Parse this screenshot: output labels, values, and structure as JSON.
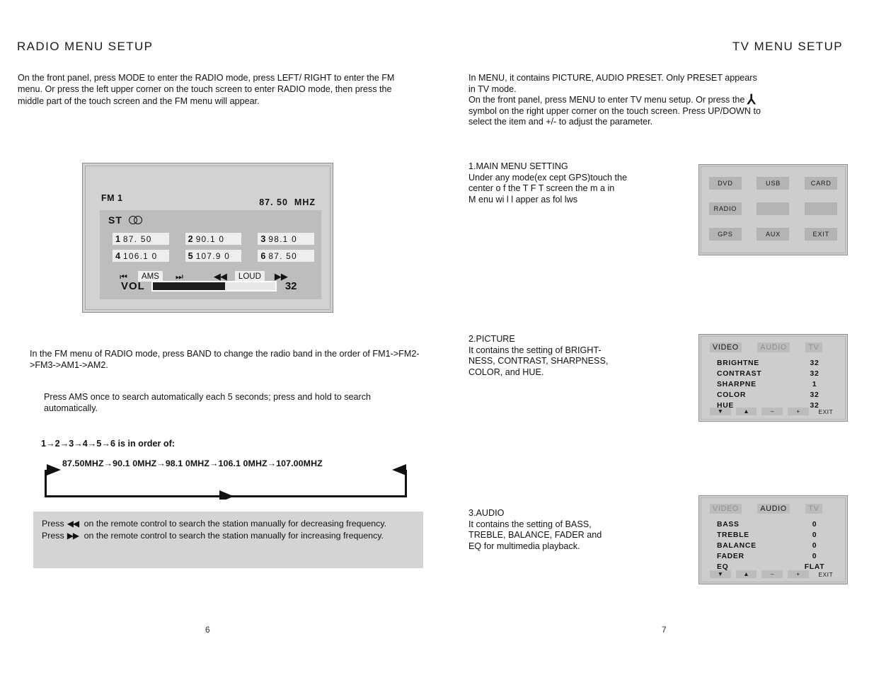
{
  "left_page": {
    "title": "RADIO MENU SETUP",
    "intro": "On the front panel, press MODE to enter the RADIO mode, press LEFT/ RIGHT to enter the FM menu. Or press the left upper corner on the touch screen to enter RADIO mode, then press the middle part of the touch screen and the FM menu will appear.",
    "radio_panel": {
      "band": "FM 1",
      "frequency": "87. 50",
      "frequency_unit": "MHZ",
      "stereo_label": "ST",
      "stereo_icon": "stereo-circles-icon",
      "presets": [
        {
          "num": "1",
          "value": "87. 50"
        },
        {
          "num": "2",
          "value": "90.1 0"
        },
        {
          "num": "3",
          "value": "98.1 0"
        },
        {
          "num": "4",
          "value": "106.1 0"
        },
        {
          "num": "5",
          "value": "107.9 0"
        },
        {
          "num": "6",
          "value": "87. 50"
        }
      ],
      "controls": [
        {
          "label": "⏮",
          "name": "prev-track-button",
          "boxed": false
        },
        {
          "label": "AMS",
          "name": "ams-button",
          "boxed": true
        },
        {
          "label": "⏭",
          "name": "next-track-button",
          "boxed": false
        },
        {
          "label": "◀◀",
          "name": "rewind-button",
          "boxed": false
        },
        {
          "label": "LOUD",
          "name": "loud-button",
          "boxed": true
        },
        {
          "label": "▶▶",
          "name": "fast-forward-button",
          "boxed": false
        }
      ],
      "vol_label": "VOL",
      "vol_value": "32",
      "vol_percent": 59
    },
    "band_text": "In the FM menu of RADIO mode, press BAND to change the radio band in the order of FM1->FM2->FM3->AM1->AM2.",
    "ams_text": "Press AMS once to search automatically each 5 seconds; press and hold to search automatically.",
    "order_label": "1→2→3→4→5→6 is in order of:",
    "flow_sequence": "87.50MHZ→90.1 0MHZ→98.1 0MHZ→106.1 0MHZ→107.00MHZ",
    "note": {
      "line1_pre": "Press",
      "line1_glyph": "◀◀",
      "line1_post": "on the remote control to search the station manually for decreasing frequency.",
      "line2_pre": "Press",
      "line2_glyph": "▶▶",
      "line2_post": "on the remote control to search the station manually for increasing frequency."
    },
    "page_number": "6"
  },
  "right_page": {
    "title": "TV MENU SETUP",
    "intro_line1": "In MENU, it contains PICTURE, AUDIO PRESET. Only PRESET appears",
    "intro_line2": "in TV mode.",
    "intro_line3a": "On the front panel, press MENU to enter TV menu setup. Or press the",
    "intro_symbol": "⅄",
    "intro_line4": "symbol on the right upper corner on the touch screen. Press UP/DOWN to",
    "intro_line5": "select the item and +/- to adjust the parameter.",
    "sections": [
      {
        "heading": "1.MAIN MENU SETTING",
        "body_lines": [
          "Under any mode(ex cept GPS)touch the",
          "center o f the T F T screen  the m a in",
          "M enu wi l l apper  as fol lws"
        ]
      },
      {
        "heading": "2.PICTURE",
        "body_lines": [
          "It contains the setting of BRIGHT-",
          "NESS, CONTRAST, SHARPNESS,",
          "COLOR, and HUE."
        ]
      },
      {
        "heading": "3.AUDIO",
        "body_lines": [
          "It contains the setting of BASS,",
          "TREBLE, BALANCE, FADER and",
          "EQ for multimedia playback."
        ]
      }
    ],
    "main_menu_panel": {
      "keys": [
        {
          "label": "DVD",
          "blank": false
        },
        {
          "label": "USB",
          "blank": false
        },
        {
          "label": "CARD",
          "blank": false
        },
        {
          "label": "RADIO",
          "blank": false
        },
        {
          "label": "",
          "blank": true
        },
        {
          "label": "",
          "blank": true
        },
        {
          "label": "GPS",
          "blank": false
        },
        {
          "label": "AUX",
          "blank": false
        },
        {
          "label": "EXIT",
          "blank": false
        }
      ]
    },
    "picture_panel": {
      "tabs": [
        {
          "label": "VIDEO",
          "active": true
        },
        {
          "label": "AUDIO",
          "active": false
        },
        {
          "label": "TV",
          "active": false
        }
      ],
      "rows": [
        {
          "name": "BRIGHTNE",
          "value": "32"
        },
        {
          "name": "CONTRAST",
          "value": "32"
        },
        {
          "name": "SHARPNE",
          "value": "1"
        },
        {
          "name": "COLOR",
          "value": "32"
        },
        {
          "name": "HUE",
          "value": "32"
        }
      ],
      "buttons": [
        {
          "label": "▼",
          "name": "down-button"
        },
        {
          "label": "▲",
          "name": "up-button"
        },
        {
          "label": "–",
          "name": "minus-button"
        },
        {
          "label": "+",
          "name": "plus-button"
        }
      ],
      "exit_label": "EXIT"
    },
    "audio_panel": {
      "tabs": [
        {
          "label": "VIDEO",
          "active": false
        },
        {
          "label": "AUDIO",
          "active": true
        },
        {
          "label": "TV",
          "active": false
        }
      ],
      "rows": [
        {
          "name": "BASS",
          "value": "0"
        },
        {
          "name": "TREBLE",
          "value": "0"
        },
        {
          "name": "BALANCE",
          "value": "0"
        },
        {
          "name": "FADER",
          "value": "0"
        },
        {
          "name": "EQ",
          "value": "FLAT"
        }
      ],
      "buttons": [
        {
          "label": "▼",
          "name": "down-button"
        },
        {
          "label": "▲",
          "name": "up-button"
        },
        {
          "label": "–",
          "name": "minus-button"
        },
        {
          "label": "+",
          "name": "plus-button"
        }
      ],
      "exit_label": "EXIT"
    },
    "page_number": "7"
  },
  "colors": {
    "panel_bg": "#d2d2d2",
    "screen_bg": "#bdbdbd",
    "key_bg": "#b4b4b4",
    "note_bg": "#d4d4d4",
    "text": "#131313"
  }
}
